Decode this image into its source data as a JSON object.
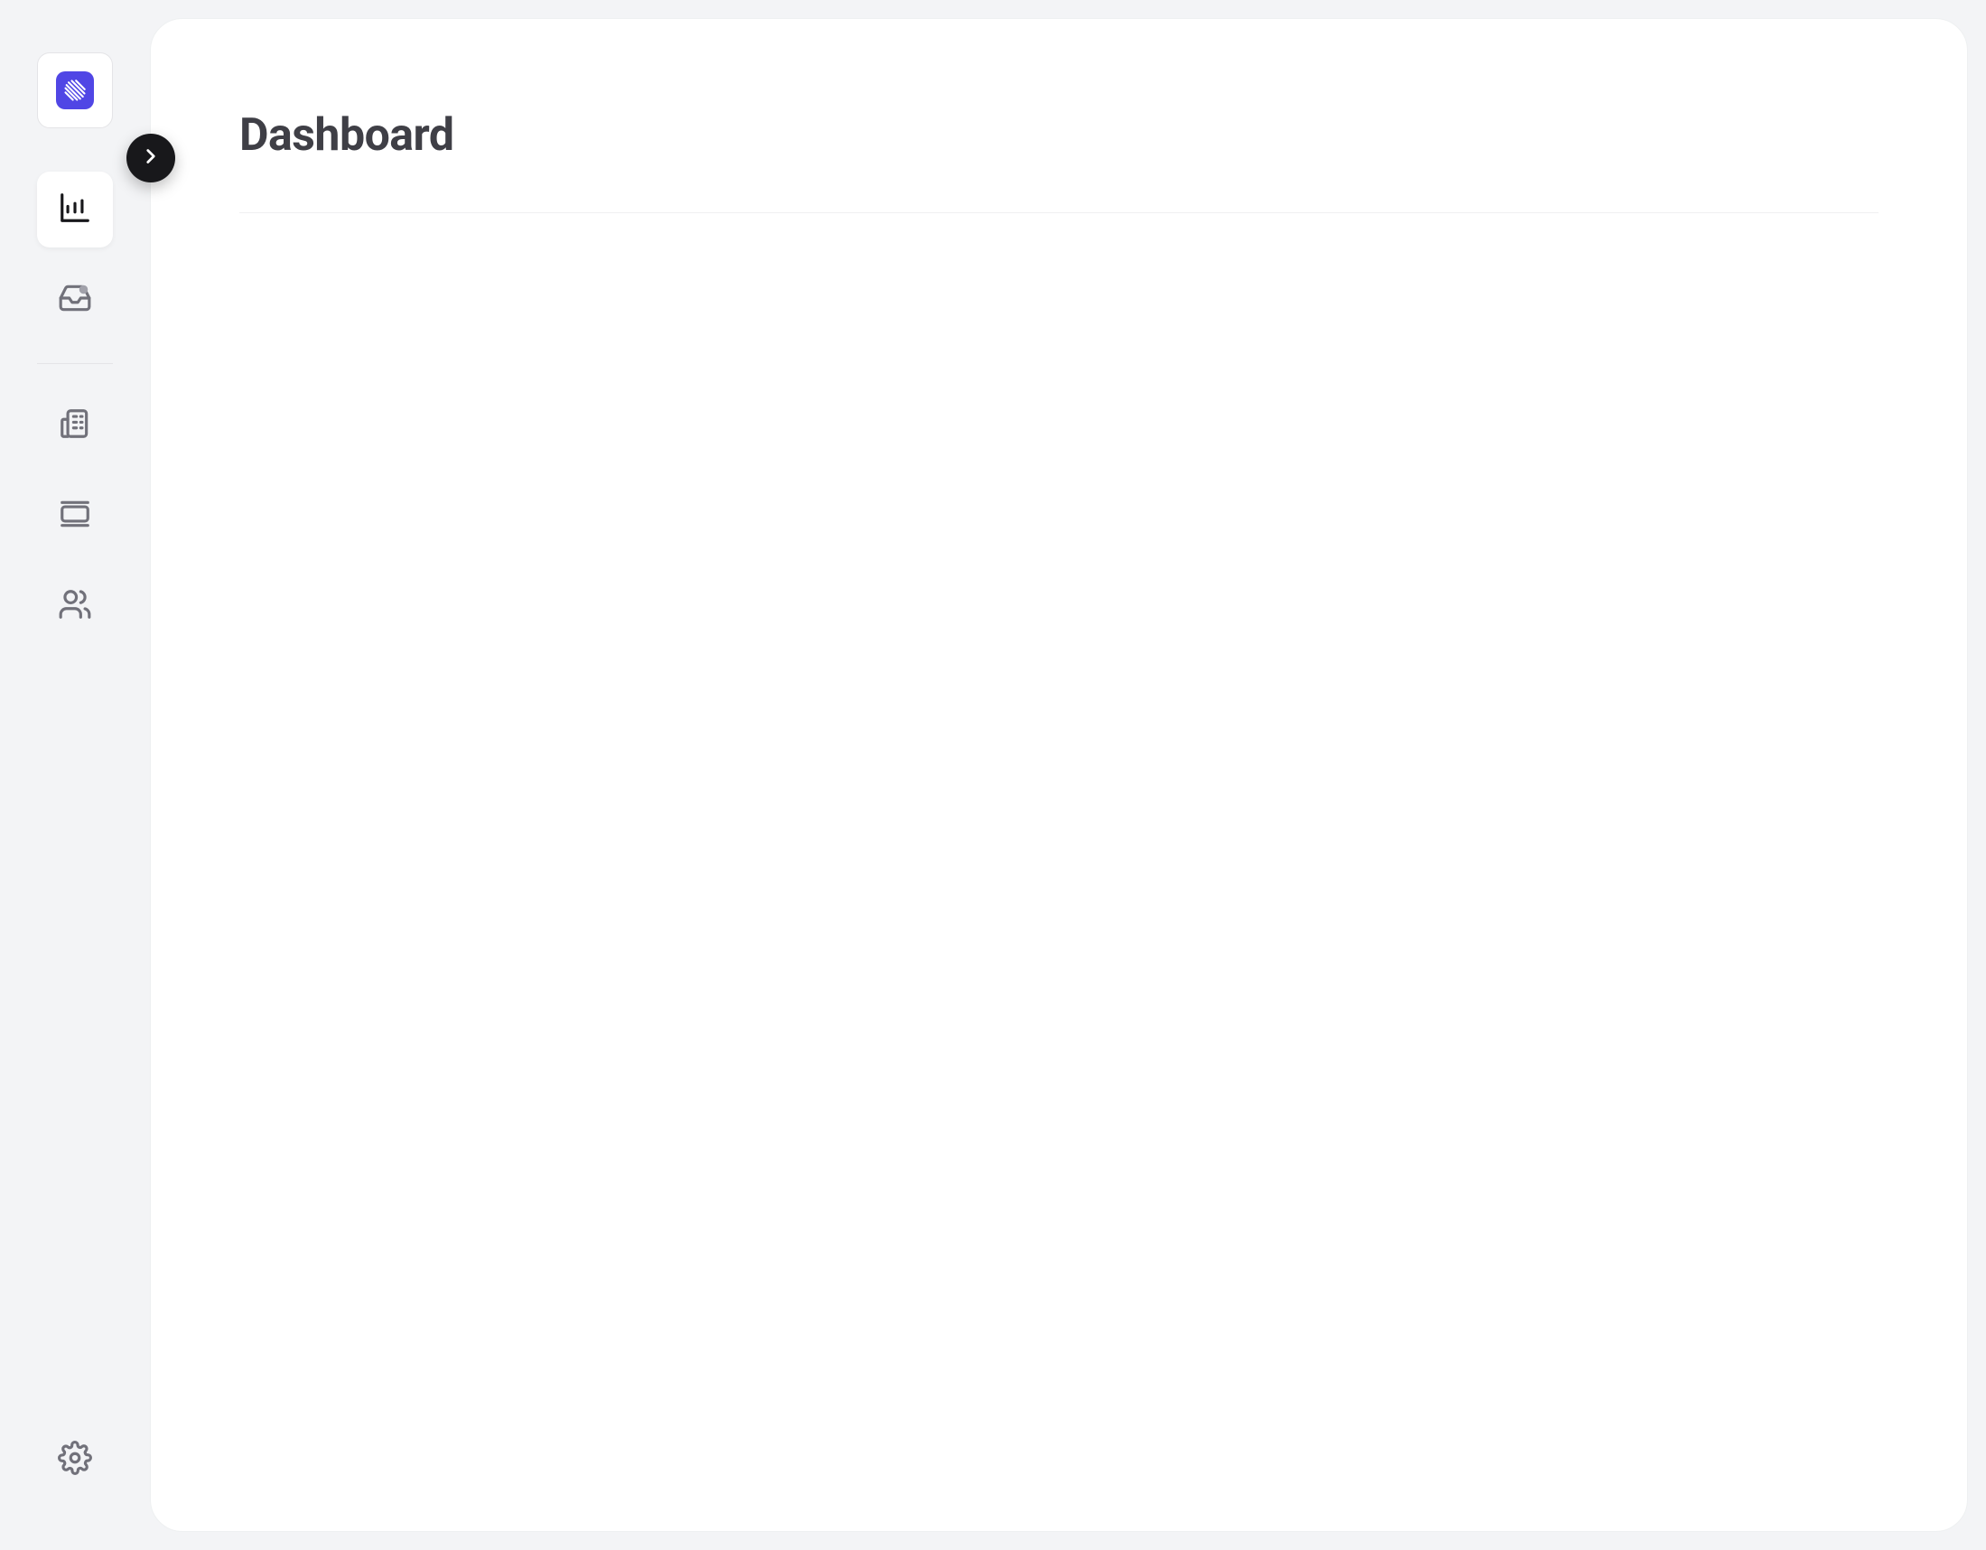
{
  "page": {
    "title": "Dashboard"
  },
  "sidebar": {
    "logo_icon": "linear-logo",
    "expand_icon": "chevron-right",
    "items_top": [
      {
        "icon": "bar-chart",
        "active": true,
        "name": "dashboard"
      },
      {
        "icon": "inbox",
        "active": false,
        "name": "inbox"
      }
    ],
    "items_mid": [
      {
        "icon": "building",
        "active": false,
        "name": "organization"
      },
      {
        "icon": "panel",
        "active": false,
        "name": "projects"
      },
      {
        "icon": "users",
        "active": false,
        "name": "team"
      }
    ],
    "item_bottom": {
      "icon": "settings",
      "name": "settings"
    }
  },
  "colors": {
    "accent": "#5046e5",
    "bg": "#f3f4f6",
    "card": "#ffffff",
    "text": "#3f3f46",
    "muted": "#71717a"
  }
}
